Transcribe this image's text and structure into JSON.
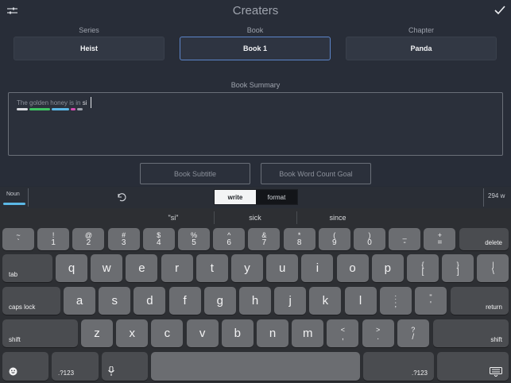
{
  "header": {
    "title": "Creaters"
  },
  "fields": {
    "series": {
      "label": "Series",
      "value": "Heist"
    },
    "book": {
      "label": "Book",
      "value": "Book 1"
    },
    "chapter": {
      "label": "Chapter",
      "value": "Panda"
    }
  },
  "summary": {
    "label": "Book Summary",
    "text": "The golden honey is in si",
    "text_before_highlight": "The golden honey is in ",
    "text_highlight": "si",
    "word_bars": [
      {
        "color": "#d9dbe0",
        "width": 14
      },
      {
        "color": "#3fc463",
        "width": 26
      },
      {
        "color": "#5bb8e6",
        "width": 22
      },
      {
        "color": "#d54ab3",
        "width": 6
      },
      {
        "color": "#9ea3ad",
        "width": 7
      }
    ]
  },
  "buttons": {
    "subtitle": "Book Subtitle",
    "goal": "Book Word Count Goal"
  },
  "toolbar": {
    "part_of_speech": "Noun",
    "tabs": [
      "write",
      "format"
    ],
    "active_tab": "write",
    "word_count": "294 w"
  },
  "suggestions": [
    "\"si\"",
    "sick",
    "since"
  ],
  "keyboard": {
    "number_row": [
      {
        "top": "~",
        "bottom": "`"
      },
      {
        "top": "!",
        "bottom": "1"
      },
      {
        "top": "@",
        "bottom": "2"
      },
      {
        "top": "#",
        "bottom": "3"
      },
      {
        "top": "$",
        "bottom": "4"
      },
      {
        "top": "%",
        "bottom": "5"
      },
      {
        "top": "^",
        "bottom": "6"
      },
      {
        "top": "&",
        "bottom": "7"
      },
      {
        "top": "*",
        "bottom": "8"
      },
      {
        "top": "(",
        "bottom": "9"
      },
      {
        "top": ")",
        "bottom": "0"
      },
      {
        "top": "_",
        "bottom": "-"
      },
      {
        "top": "+",
        "bottom": "="
      }
    ],
    "delete": "delete",
    "tab": "tab",
    "row_q": [
      "q",
      "w",
      "e",
      "r",
      "t",
      "y",
      "u",
      "i",
      "o",
      "p"
    ],
    "row_q_extra": [
      {
        "top": "{",
        "bottom": "["
      },
      {
        "top": "}",
        "bottom": "]"
      },
      {
        "top": "|",
        "bottom": "\\"
      }
    ],
    "caps_lock": "caps lock",
    "row_a": [
      "a",
      "s",
      "d",
      "f",
      "g",
      "h",
      "j",
      "k",
      "l"
    ],
    "row_a_extra": [
      {
        "top": ":",
        "bottom": ";"
      },
      {
        "top": "\"",
        "bottom": "'"
      }
    ],
    "return": "return",
    "shift": "shift",
    "row_z": [
      "z",
      "x",
      "c",
      "v",
      "b",
      "n",
      "m"
    ],
    "row_z_extra": [
      {
        "top": "<",
        "bottom": ","
      },
      {
        "top": ">",
        "bottom": "."
      },
      {
        "top": "?",
        "bottom": "/"
      }
    ],
    "numbers_toggle": ".?123"
  },
  "colors": {
    "accent_border": "#5c84c9",
    "noun_bar": "#5bb8e6"
  }
}
